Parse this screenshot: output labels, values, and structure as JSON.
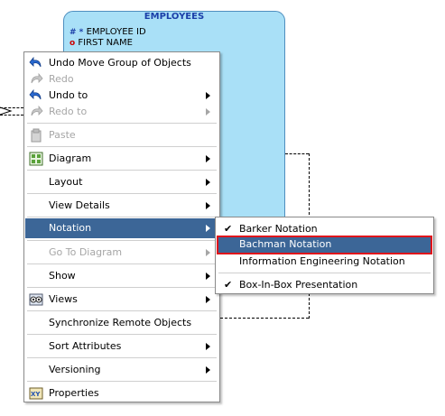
{
  "entity": {
    "title": "EMPLOYEES",
    "attributes": [
      {
        "markers": "# *",
        "name": "EMPLOYEE ID"
      },
      {
        "markers": "o",
        "name": "FIRST NAME"
      }
    ]
  },
  "context_menu": {
    "items": [
      {
        "id": "undo",
        "label": "Undo Move Group of Objects",
        "icon": "undo-icon",
        "enabled": true,
        "submenu": false
      },
      {
        "id": "redo",
        "label": "Redo",
        "icon": "redo-icon",
        "enabled": false,
        "submenu": false
      },
      {
        "id": "undo-to",
        "label": "Undo to",
        "icon": "undo-icon",
        "enabled": true,
        "submenu": true
      },
      {
        "id": "redo-to",
        "label": "Redo to",
        "icon": "redo-icon",
        "enabled": false,
        "submenu": true
      },
      {
        "id": "paste",
        "label": "Paste",
        "icon": "paste-icon",
        "enabled": false,
        "submenu": false
      },
      {
        "id": "diagram",
        "label": "Diagram",
        "icon": "diagram-icon",
        "enabled": true,
        "submenu": true
      },
      {
        "id": "layout",
        "label": "Layout",
        "enabled": true,
        "submenu": true
      },
      {
        "id": "view-details",
        "label": "View Details",
        "enabled": true,
        "submenu": true
      },
      {
        "id": "notation",
        "label": "Notation",
        "enabled": true,
        "submenu": true,
        "selected": true
      },
      {
        "id": "go-to-diagram",
        "label": "Go To Diagram",
        "enabled": false,
        "submenu": true
      },
      {
        "id": "show",
        "label": "Show",
        "enabled": true,
        "submenu": true
      },
      {
        "id": "views",
        "label": "Views",
        "icon": "views-icon",
        "enabled": true,
        "submenu": true
      },
      {
        "id": "sync-remote",
        "label": "Synchronize Remote Objects",
        "enabled": true,
        "submenu": false
      },
      {
        "id": "sort-attributes",
        "label": "Sort Attributes",
        "enabled": true,
        "submenu": true
      },
      {
        "id": "versioning",
        "label": "Versioning",
        "enabled": true,
        "submenu": true
      },
      {
        "id": "properties",
        "label": "Properties",
        "icon": "properties-icon",
        "enabled": true,
        "submenu": false
      }
    ]
  },
  "notation_submenu": {
    "check_glyph": "✔",
    "items": [
      {
        "id": "barker",
        "label": "Barker Notation",
        "checked": true
      },
      {
        "id": "bachman",
        "label": "Bachman Notation",
        "checked": false,
        "highlighted": true
      },
      {
        "id": "ie",
        "label": "Information Engineering Notation",
        "checked": false
      },
      {
        "id": "box-in-box",
        "label": "Box-In-Box Presentation",
        "checked": true
      }
    ]
  },
  "colors": {
    "entity_fill": "#a9e0f7",
    "entity_title": "#1b3fa8",
    "selection": "#3c6697",
    "highlight_border": "#e0151b",
    "disabled_text": "#a6a6a6"
  }
}
